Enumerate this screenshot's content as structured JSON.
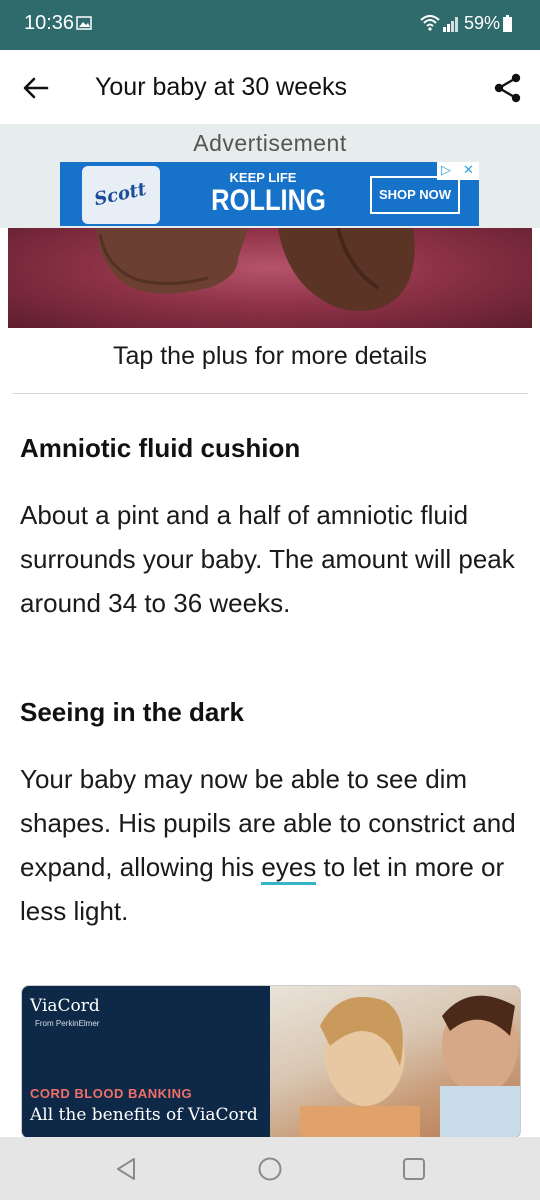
{
  "status_bar": {
    "time": "10:36",
    "battery": "59%",
    "icons": [
      "image-icon",
      "wifi-icon",
      "signal-icon",
      "battery-icon"
    ]
  },
  "app_bar": {
    "title": "Your baby at 30 weeks",
    "back_icon": "arrow-left-icon",
    "share_icon": "share-icon"
  },
  "ad_top": {
    "label": "Advertisement",
    "logo_text": "Scott",
    "tagline_small": "KEEP LIFE",
    "tagline_big": "ROLLING",
    "cta": "SHOP NOW",
    "colors": {
      "background": "#1772c9",
      "text": "#ffffff"
    }
  },
  "hero": {
    "caption": "Tap the plus for more details"
  },
  "sections": [
    {
      "heading": "Amniotic fluid cushion",
      "body": "About a pint and a half of amniotic fluid surrounds your baby. The amount will peak around 34 to 36 weeks."
    },
    {
      "heading": "Seeing in the dark",
      "body_before_link": "Your baby may now be able to see dim shapes. His pupils are able to constrict and expand, allowing his ",
      "link_text": "eyes",
      "body_after_link": " to let in more or less light."
    }
  ],
  "ad_bottom": {
    "brand": "ViaCord",
    "brand_sub": "From PerkinElmer",
    "headline": "CORD BLOOD BANKING",
    "body": "All the benefits of ViaCord"
  },
  "nav_bar": {
    "buttons": [
      "back-triangle-icon",
      "home-circle-icon",
      "recents-square-icon"
    ]
  },
  "colors": {
    "status_bar": "#2f6b6d",
    "link_underline": "#35b3c8",
    "ad_area": "#e7ecec",
    "nav_bar": "#e5e5e5"
  }
}
